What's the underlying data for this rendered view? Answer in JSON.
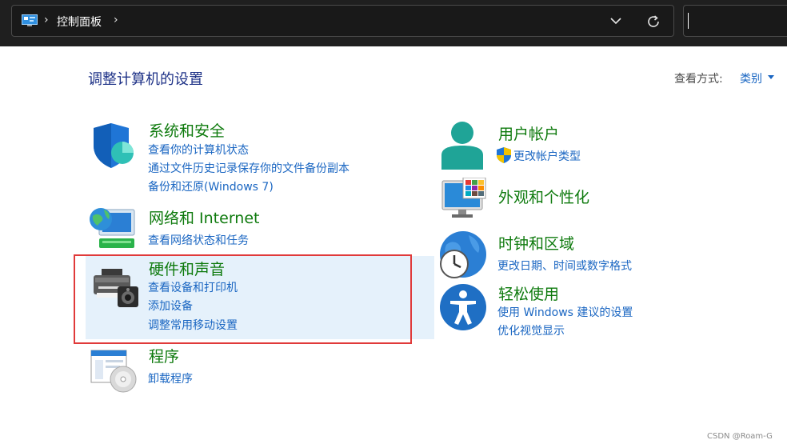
{
  "address_bar": {
    "breadcrumb_separator": "›",
    "location": "控制面板"
  },
  "header": {
    "title": "调整计算机的设置",
    "view_by_label": "查看方式:",
    "view_by_value": "类别"
  },
  "categories_left": [
    {
      "title": "系统和安全",
      "links": [
        "查看你的计算机状态",
        "通过文件历史记录保存你的文件备份副本",
        "备份和还原(Windows 7)"
      ]
    },
    {
      "title": "网络和 Internet",
      "links": [
        "查看网络状态和任务"
      ]
    },
    {
      "title": "硬件和声音",
      "links": [
        "查看设备和打印机",
        "添加设备",
        "调整常用移动设置"
      ]
    },
    {
      "title": "程序",
      "links": [
        "卸载程序"
      ]
    }
  ],
  "categories_right": [
    {
      "title": "用户帐户",
      "links": [
        "更改帐户类型"
      ]
    },
    {
      "title": "外观和个性化",
      "links": []
    },
    {
      "title": "时钟和区域",
      "links": [
        "更改日期、时间或数字格式"
      ]
    },
    {
      "title": "轻松使用",
      "links": [
        "使用 Windows 建议的设置",
        "优化视觉显示"
      ]
    }
  ],
  "watermark": "CSDN @Roam-G",
  "colors": {
    "category_title": "#0e7a0d",
    "link": "#1a66c2",
    "page_title": "#1e3287",
    "highlight": "#e5f1fb",
    "annotation_box": "#e03a3a"
  }
}
